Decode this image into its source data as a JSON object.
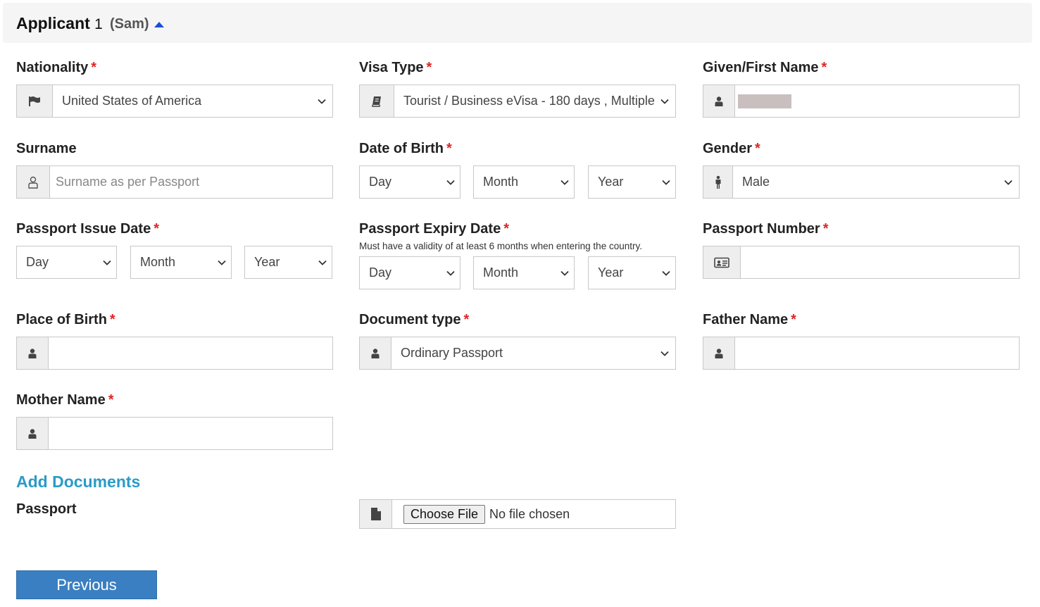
{
  "header": {
    "title": "Applicant",
    "number": "1",
    "name": "(Sam)"
  },
  "fields": {
    "nationality": {
      "label": "Nationality",
      "required": "*",
      "value": "United States of America"
    },
    "visa_type": {
      "label": "Visa Type",
      "required": "*",
      "value": "Tourist / Business eVisa - 180 days , Multiple"
    },
    "given_name": {
      "label": "Given/First Name",
      "required": "*"
    },
    "surname": {
      "label": "Surname",
      "placeholder": "Surname as per Passport"
    },
    "dob": {
      "label": "Date of Birth",
      "required": "*",
      "day": "Day",
      "month": "Month",
      "year": "Year"
    },
    "gender": {
      "label": "Gender",
      "required": "*",
      "value": "Male"
    },
    "passport_issue": {
      "label": "Passport Issue Date",
      "required": "*",
      "day": "Day",
      "month": "Month",
      "year": "Year"
    },
    "passport_expiry": {
      "label": "Passport Expiry Date",
      "required": "*",
      "note": "Must have a validity of at least 6 months when entering the country.",
      "day": "Day",
      "month": "Month",
      "year": "Year"
    },
    "passport_number": {
      "label": "Passport Number",
      "required": "*"
    },
    "place_of_birth": {
      "label": "Place of Birth",
      "required": "*"
    },
    "document_type": {
      "label": "Document type",
      "required": "*",
      "value": "Ordinary Passport"
    },
    "father_name": {
      "label": "Father Name",
      "required": "*"
    },
    "mother_name": {
      "label": "Mother Name",
      "required": "*"
    }
  },
  "documents": {
    "heading": "Add Documents",
    "passport_label": "Passport",
    "choose_file": "Choose File",
    "no_file": "No file chosen"
  },
  "buttons": {
    "previous": "Previous"
  },
  "colors": {
    "required": "#e02424",
    "link": "#2a9bc7",
    "primary": "#3a7fc1",
    "caret": "#1a4fd8"
  }
}
